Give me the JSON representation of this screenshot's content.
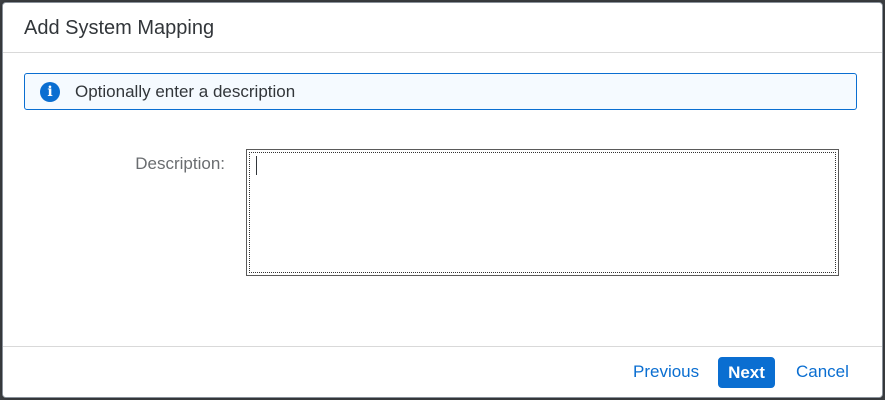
{
  "dialog": {
    "title": "Add System Mapping"
  },
  "info_strip": {
    "icon": "info-icon",
    "icon_glyph": "i",
    "text": "Optionally enter a description",
    "accent_color": "#0a6ed1"
  },
  "form": {
    "description_label": "Description:",
    "description_value": ""
  },
  "footer": {
    "previous_label": "Previous",
    "next_label": "Next",
    "cancel_label": "Cancel"
  }
}
